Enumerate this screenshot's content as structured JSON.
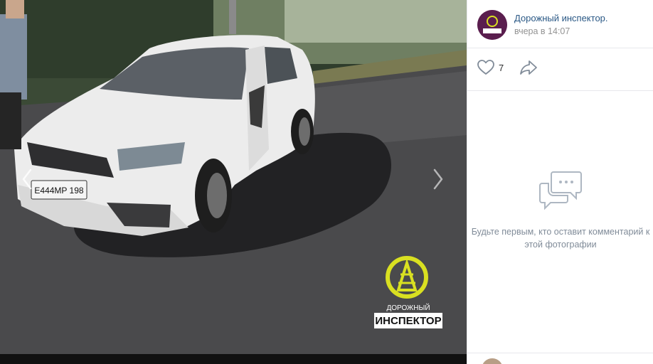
{
  "photo": {
    "plate_text": "E444MP 198",
    "watermark_line1": "ДОРОЖНЫЙ",
    "watermark_line2": "ИНСПЕКТОР",
    "accent": "#d9e021"
  },
  "nav": {
    "prev_icon": "chevron-left-icon",
    "next_icon": "chevron-right-icon"
  },
  "author": {
    "name": "Дорожный инспектор.",
    "date": "вчера в 14:07"
  },
  "actions": {
    "likes": "7",
    "like_icon": "heart-icon",
    "share_icon": "share-icon"
  },
  "comments": {
    "empty_text": "Будьте первым, кто оставит комментарий к этой фотографии",
    "empty_icon": "comments-icon"
  }
}
